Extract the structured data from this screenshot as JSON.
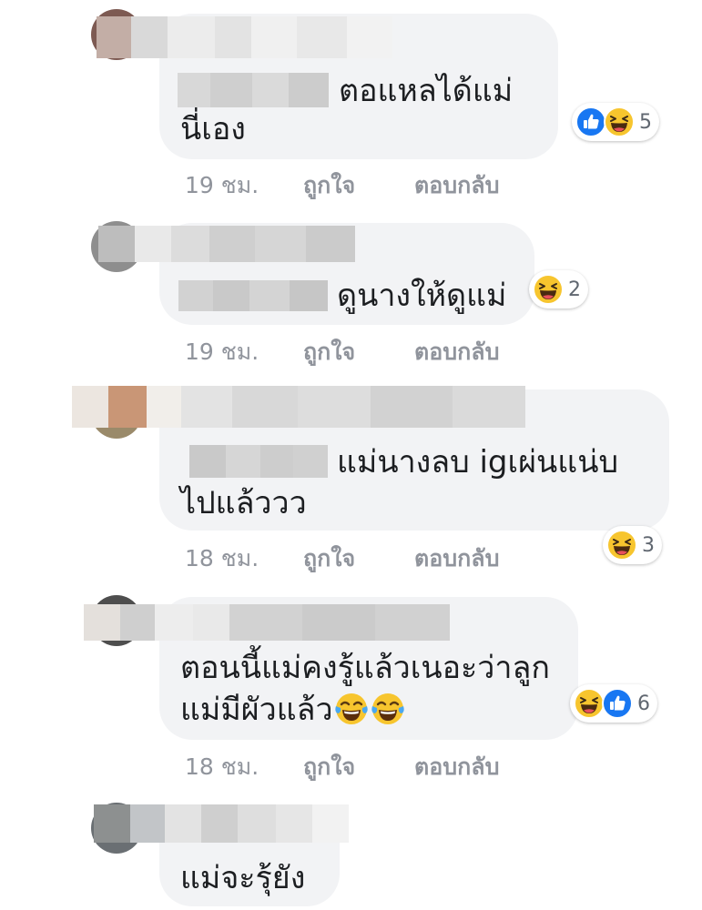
{
  "colors": {
    "bubble": "#f2f3f5",
    "meta_text": "#90949c",
    "like_blue": "#1877f2",
    "emoji_yellow": "#f7c52e"
  },
  "comments": [
    {
      "text_lines": [
        "ตอแหลได้แม่",
        "นี่เอง"
      ],
      "time": "19 ชม.",
      "like_label": "ถูกใจ",
      "reply_label": "ตอบกลับ",
      "reactions": [
        "like-icon",
        "haha-icon"
      ],
      "reaction_count": "5"
    },
    {
      "text_lines": [
        "ดูนางให้ดูแม่"
      ],
      "time": "19 ชม.",
      "like_label": "ถูกใจ",
      "reply_label": "ตอบกลับ",
      "reactions": [
        "haha-icon"
      ],
      "reaction_count": "2"
    },
    {
      "text_lines": [
        "แม่นางลบ igเผ่นแน่บ",
        "ไปแล้ววว"
      ],
      "time": "18 ชม.",
      "like_label": "ถูกใจ",
      "reply_label": "ตอบกลับ",
      "reactions": [
        "haha-icon"
      ],
      "reaction_count": "3"
    },
    {
      "text_lines": [
        "ตอนนี้แม่คงรู้แล้วเนอะว่าลูก",
        "แม่มีผัวแล้ว"
      ],
      "inline_emoji": "tears-of-joy-icon",
      "time": "18 ชม.",
      "like_label": "ถูกใจ",
      "reply_label": "ตอบกลับ",
      "reactions": [
        "haha-icon",
        "like-icon"
      ],
      "reaction_count": "6"
    },
    {
      "text_lines": [
        "แม่จะรุ้ยัง"
      ]
    }
  ]
}
